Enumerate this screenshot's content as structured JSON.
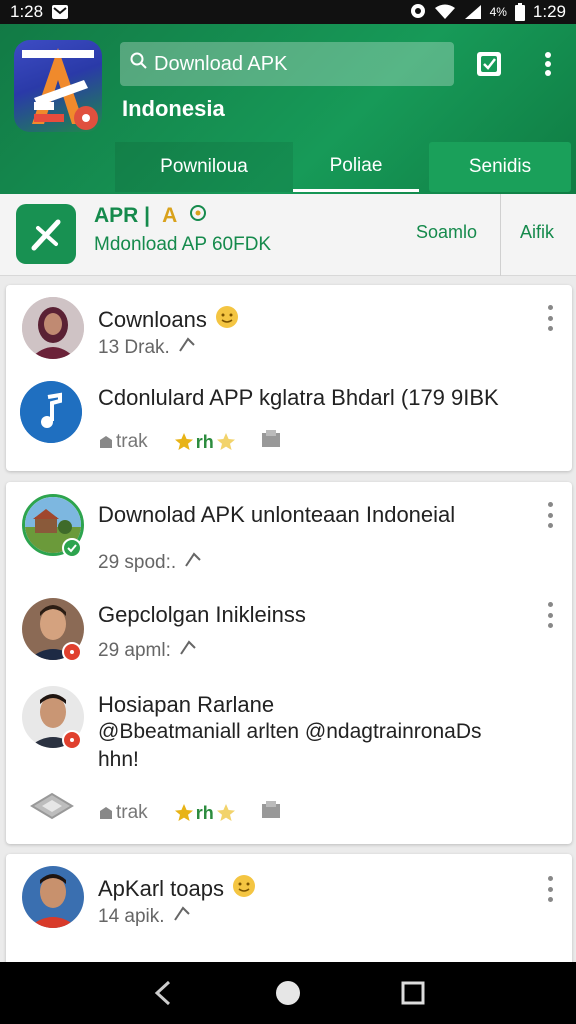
{
  "status_bar": {
    "time_left": "1:28",
    "battery_text": "4%",
    "time_right": "1:29"
  },
  "header": {
    "search_placeholder": "Download APK",
    "region": "Indonesia",
    "tabs": [
      {
        "label": "Powniloua"
      },
      {
        "label": "Poliae"
      },
      {
        "label": "Senidis"
      }
    ],
    "colors": {
      "primary": "#179a58",
      "accent": "#1aa05a"
    }
  },
  "featured": {
    "title": "APR |",
    "badge": "A",
    "subtitle": "Mdonload AP  60FDK",
    "link_1": "Soamlo",
    "link_2": "Aifik"
  },
  "cards": [
    {
      "items": [
        {
          "title": "Cownloans",
          "subtitle": "13 Drak."
        },
        {
          "title": "Cdonlulard APP kglatra Bhdarl (179 9IBK"
        }
      ],
      "actions": {
        "action_1": "trak",
        "rating": "rh"
      }
    },
    {
      "items": [
        {
          "title": "Downolad APK unlonteaan Indoneial",
          "subtitle": "29 spod:."
        },
        {
          "title": "Gepclolgan Inikleinss",
          "subtitle": "29 apml:"
        },
        {
          "title": "Hosiapan Rarlane",
          "body": "@Bbeatmaniall arlten @ndagtrainronaDs",
          "body2": "hhn!"
        }
      ],
      "actions": {
        "action_1": "trak",
        "rating": "rh"
      }
    },
    {
      "items": [
        {
          "title": "ApKarl toaps",
          "subtitle": "14 apik."
        }
      ]
    }
  ]
}
